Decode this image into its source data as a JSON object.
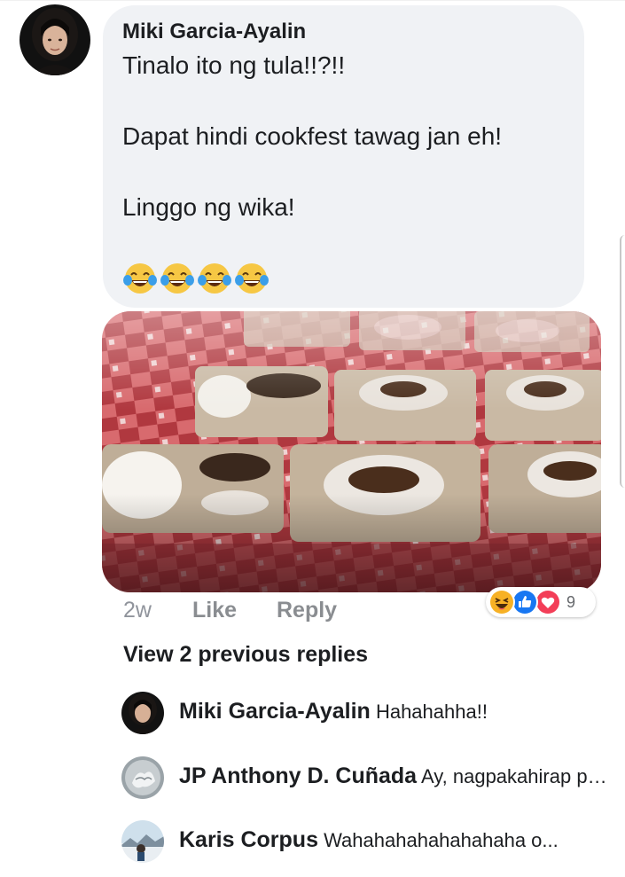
{
  "comment": {
    "author": "Miki Garcia-Ayalin",
    "lines": [
      "Tinalo ito ng tula!!?!!",
      "Dapat hindi cookfest tawag jan eh!",
      "Linggo ng wika!"
    ],
    "emoji": [
      "😂",
      "😂",
      "😂",
      "😂"
    ],
    "emoji_names": [
      "tears-of-joy-icon",
      "tears-of-joy-icon",
      "tears-of-joy-icon",
      "tears-of-joy-icon"
    ],
    "photo_alt": "food-trays-photo"
  },
  "meta": {
    "time": "2w",
    "like_label": "Like",
    "reply_label": "Reply"
  },
  "reactions": {
    "icons": [
      "haha-icon",
      "like-icon",
      "love-icon"
    ],
    "count": "9",
    "colors": {
      "haha": "#f7b125",
      "like": "#1877f2",
      "love": "#f33e58"
    }
  },
  "replies": {
    "view_previous_label": "View 2 previous replies",
    "items": [
      {
        "name": "Miki Garcia-Ayalin",
        "text": "Hahahahha!!"
      },
      {
        "name": "JP Anthony D. Cuñada",
        "text": "Ay, nagpakahirap pa..."
      },
      {
        "name": "Karis Corpus",
        "text": "Wahahahahahahahaha o..."
      }
    ]
  }
}
